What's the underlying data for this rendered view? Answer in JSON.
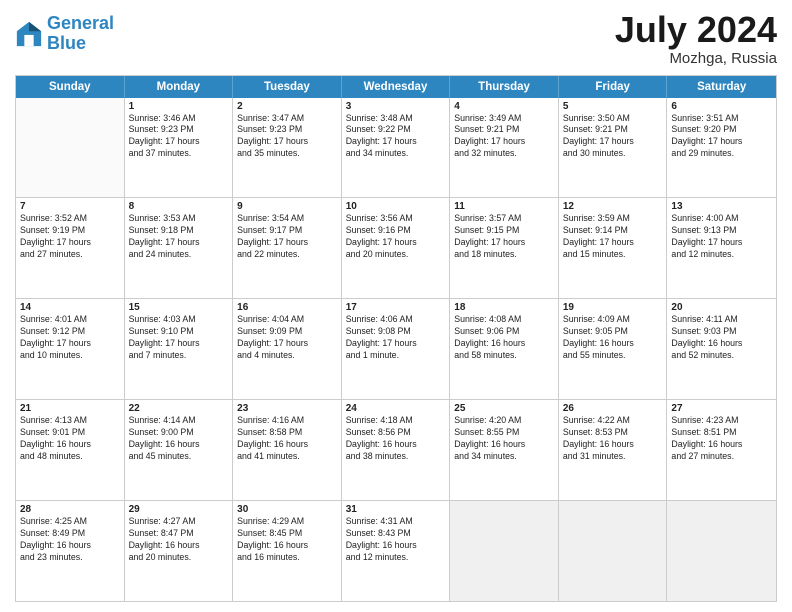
{
  "header": {
    "logo_line1": "General",
    "logo_line2": "Blue",
    "month_year": "July 2024",
    "location": "Mozhga, Russia"
  },
  "days_of_week": [
    "Sunday",
    "Monday",
    "Tuesday",
    "Wednesday",
    "Thursday",
    "Friday",
    "Saturday"
  ],
  "weeks": [
    [
      {
        "day": "",
        "info": [],
        "empty": true
      },
      {
        "day": "1",
        "info": [
          "Sunrise: 3:46 AM",
          "Sunset: 9:23 PM",
          "Daylight: 17 hours",
          "and 37 minutes."
        ]
      },
      {
        "day": "2",
        "info": [
          "Sunrise: 3:47 AM",
          "Sunset: 9:23 PM",
          "Daylight: 17 hours",
          "and 35 minutes."
        ]
      },
      {
        "day": "3",
        "info": [
          "Sunrise: 3:48 AM",
          "Sunset: 9:22 PM",
          "Daylight: 17 hours",
          "and 34 minutes."
        ]
      },
      {
        "day": "4",
        "info": [
          "Sunrise: 3:49 AM",
          "Sunset: 9:21 PM",
          "Daylight: 17 hours",
          "and 32 minutes."
        ]
      },
      {
        "day": "5",
        "info": [
          "Sunrise: 3:50 AM",
          "Sunset: 9:21 PM",
          "Daylight: 17 hours",
          "and 30 minutes."
        ]
      },
      {
        "day": "6",
        "info": [
          "Sunrise: 3:51 AM",
          "Sunset: 9:20 PM",
          "Daylight: 17 hours",
          "and 29 minutes."
        ]
      }
    ],
    [
      {
        "day": "7",
        "info": [
          "Sunrise: 3:52 AM",
          "Sunset: 9:19 PM",
          "Daylight: 17 hours",
          "and 27 minutes."
        ]
      },
      {
        "day": "8",
        "info": [
          "Sunrise: 3:53 AM",
          "Sunset: 9:18 PM",
          "Daylight: 17 hours",
          "and 24 minutes."
        ]
      },
      {
        "day": "9",
        "info": [
          "Sunrise: 3:54 AM",
          "Sunset: 9:17 PM",
          "Daylight: 17 hours",
          "and 22 minutes."
        ]
      },
      {
        "day": "10",
        "info": [
          "Sunrise: 3:56 AM",
          "Sunset: 9:16 PM",
          "Daylight: 17 hours",
          "and 20 minutes."
        ]
      },
      {
        "day": "11",
        "info": [
          "Sunrise: 3:57 AM",
          "Sunset: 9:15 PM",
          "Daylight: 17 hours",
          "and 18 minutes."
        ]
      },
      {
        "day": "12",
        "info": [
          "Sunrise: 3:59 AM",
          "Sunset: 9:14 PM",
          "Daylight: 17 hours",
          "and 15 minutes."
        ]
      },
      {
        "day": "13",
        "info": [
          "Sunrise: 4:00 AM",
          "Sunset: 9:13 PM",
          "Daylight: 17 hours",
          "and 12 minutes."
        ]
      }
    ],
    [
      {
        "day": "14",
        "info": [
          "Sunrise: 4:01 AM",
          "Sunset: 9:12 PM",
          "Daylight: 17 hours",
          "and 10 minutes."
        ]
      },
      {
        "day": "15",
        "info": [
          "Sunrise: 4:03 AM",
          "Sunset: 9:10 PM",
          "Daylight: 17 hours",
          "and 7 minutes."
        ]
      },
      {
        "day": "16",
        "info": [
          "Sunrise: 4:04 AM",
          "Sunset: 9:09 PM",
          "Daylight: 17 hours",
          "and 4 minutes."
        ]
      },
      {
        "day": "17",
        "info": [
          "Sunrise: 4:06 AM",
          "Sunset: 9:08 PM",
          "Daylight: 17 hours",
          "and 1 minute."
        ]
      },
      {
        "day": "18",
        "info": [
          "Sunrise: 4:08 AM",
          "Sunset: 9:06 PM",
          "Daylight: 16 hours",
          "and 58 minutes."
        ]
      },
      {
        "day": "19",
        "info": [
          "Sunrise: 4:09 AM",
          "Sunset: 9:05 PM",
          "Daylight: 16 hours",
          "and 55 minutes."
        ]
      },
      {
        "day": "20",
        "info": [
          "Sunrise: 4:11 AM",
          "Sunset: 9:03 PM",
          "Daylight: 16 hours",
          "and 52 minutes."
        ]
      }
    ],
    [
      {
        "day": "21",
        "info": [
          "Sunrise: 4:13 AM",
          "Sunset: 9:01 PM",
          "Daylight: 16 hours",
          "and 48 minutes."
        ]
      },
      {
        "day": "22",
        "info": [
          "Sunrise: 4:14 AM",
          "Sunset: 9:00 PM",
          "Daylight: 16 hours",
          "and 45 minutes."
        ]
      },
      {
        "day": "23",
        "info": [
          "Sunrise: 4:16 AM",
          "Sunset: 8:58 PM",
          "Daylight: 16 hours",
          "and 41 minutes."
        ]
      },
      {
        "day": "24",
        "info": [
          "Sunrise: 4:18 AM",
          "Sunset: 8:56 PM",
          "Daylight: 16 hours",
          "and 38 minutes."
        ]
      },
      {
        "day": "25",
        "info": [
          "Sunrise: 4:20 AM",
          "Sunset: 8:55 PM",
          "Daylight: 16 hours",
          "and 34 minutes."
        ]
      },
      {
        "day": "26",
        "info": [
          "Sunrise: 4:22 AM",
          "Sunset: 8:53 PM",
          "Daylight: 16 hours",
          "and 31 minutes."
        ]
      },
      {
        "day": "27",
        "info": [
          "Sunrise: 4:23 AM",
          "Sunset: 8:51 PM",
          "Daylight: 16 hours",
          "and 27 minutes."
        ]
      }
    ],
    [
      {
        "day": "28",
        "info": [
          "Sunrise: 4:25 AM",
          "Sunset: 8:49 PM",
          "Daylight: 16 hours",
          "and 23 minutes."
        ]
      },
      {
        "day": "29",
        "info": [
          "Sunrise: 4:27 AM",
          "Sunset: 8:47 PM",
          "Daylight: 16 hours",
          "and 20 minutes."
        ]
      },
      {
        "day": "30",
        "info": [
          "Sunrise: 4:29 AM",
          "Sunset: 8:45 PM",
          "Daylight: 16 hours",
          "and 16 minutes."
        ]
      },
      {
        "day": "31",
        "info": [
          "Sunrise: 4:31 AM",
          "Sunset: 8:43 PM",
          "Daylight: 16 hours",
          "and 12 minutes."
        ]
      },
      {
        "day": "",
        "info": [],
        "empty": true,
        "shaded": true
      },
      {
        "day": "",
        "info": [],
        "empty": true,
        "shaded": true
      },
      {
        "day": "",
        "info": [],
        "empty": true,
        "shaded": true
      }
    ]
  ]
}
